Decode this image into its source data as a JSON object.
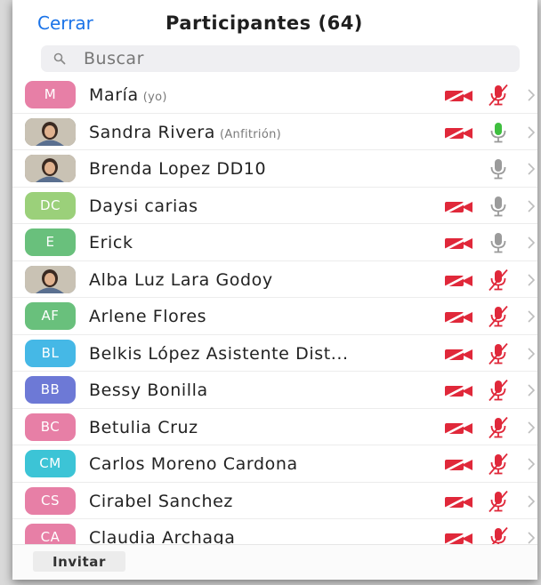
{
  "header": {
    "close_label": "Cerrar",
    "title": "Participantes (64)"
  },
  "search": {
    "placeholder": "Buscar"
  },
  "colors": {
    "accent": "#1a73e8",
    "muted_red": "#e0283a",
    "unmuted_green": "#3fbf3f",
    "mic_gray": "#9b9b9b"
  },
  "participants": [
    {
      "name": "María",
      "role": "(yo)",
      "initials": "M",
      "avatar_color": "#e77fa6",
      "photo": false,
      "video": "off",
      "mic": "muted"
    },
    {
      "name": "Sandra Rivera",
      "role": "(Anfitrión)",
      "initials": "",
      "avatar_color": "#6d6b5a",
      "photo": true,
      "video": "off",
      "mic": "on"
    },
    {
      "name": "Brenda Lopez DD10",
      "role": "",
      "initials": "",
      "avatar_color": "#8a6a5a",
      "photo": true,
      "video": "none",
      "mic": "idle"
    },
    {
      "name": "Daysi carias",
      "role": "",
      "initials": "DC",
      "avatar_color": "#9bd07a",
      "photo": false,
      "video": "off",
      "mic": "idle"
    },
    {
      "name": "Erick",
      "role": "",
      "initials": "E",
      "avatar_color": "#69c07c",
      "photo": false,
      "video": "off",
      "mic": "idle"
    },
    {
      "name": "Alba Luz Lara Godoy",
      "role": "",
      "initials": "",
      "avatar_color": "#7d8aa0",
      "photo": true,
      "video": "off",
      "mic": "muted"
    },
    {
      "name": "Arlene Flores",
      "role": "",
      "initials": "AF",
      "avatar_color": "#69c07c",
      "photo": false,
      "video": "off",
      "mic": "muted"
    },
    {
      "name": "Belkis López Asistente Dist...",
      "role": "",
      "initials": "BL",
      "avatar_color": "#45b8e6",
      "photo": false,
      "video": "off",
      "mic": "muted"
    },
    {
      "name": "Bessy Bonilla",
      "role": "",
      "initials": "BB",
      "avatar_color": "#6d79d6",
      "photo": false,
      "video": "off",
      "mic": "muted"
    },
    {
      "name": "Betulia Cruz",
      "role": "",
      "initials": "BC",
      "avatar_color": "#e77fa6",
      "photo": false,
      "video": "off",
      "mic": "muted"
    },
    {
      "name": "Carlos Moreno Cardona",
      "role": "",
      "initials": "CM",
      "avatar_color": "#3cc4d6",
      "photo": false,
      "video": "off",
      "mic": "muted"
    },
    {
      "name": "Cirabel Sanchez",
      "role": "",
      "initials": "CS",
      "avatar_color": "#e77fa6",
      "photo": false,
      "video": "off",
      "mic": "muted"
    },
    {
      "name": "Claudia Archaga",
      "role": "",
      "initials": "CA",
      "avatar_color": "#e77fa6",
      "photo": false,
      "video": "off",
      "mic": "muted"
    }
  ],
  "footer": {
    "invite_label": "Invitar"
  }
}
